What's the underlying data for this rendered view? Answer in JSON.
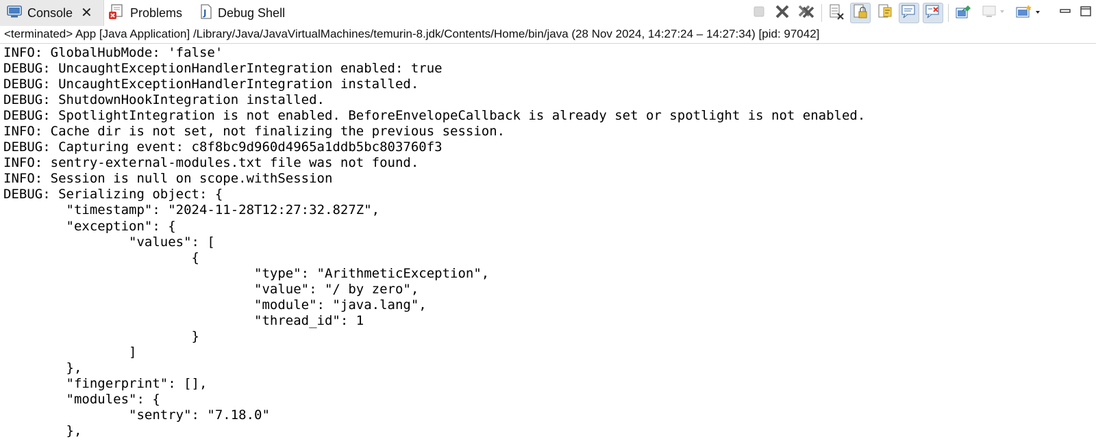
{
  "tabs": [
    {
      "label": "Console",
      "icon": "console-icon",
      "active": true
    },
    {
      "label": "Problems",
      "icon": "problems-icon",
      "active": false
    },
    {
      "label": "Debug Shell",
      "icon": "debug-shell-icon",
      "active": false
    }
  ],
  "toolbar": {
    "icons": [
      "terminate-icon",
      "remove-launch-icon",
      "remove-all-terminated-icon",
      "clear-console-icon",
      "scroll-lock-icon",
      "word-wrap-icon",
      "show-on-stdout-icon",
      "show-on-stderr-icon",
      "pin-console-icon",
      "display-selected-console-icon",
      "open-console-icon",
      "minimize-icon",
      "maximize-icon"
    ]
  },
  "status": {
    "text": "<terminated> App [Java Application] /Library/Java/JavaVirtualMachines/temurin-8.jdk/Contents/Home/bin/java  (28 Nov 2024, 14:27:24 – 14:27:34) [pid: 97042]"
  },
  "console": {
    "lines": [
      "INFO: GlobalHubMode: 'false'",
      "DEBUG: UncaughtExceptionHandlerIntegration enabled: true",
      "DEBUG: UncaughtExceptionHandlerIntegration installed.",
      "DEBUG: ShutdownHookIntegration installed.",
      "DEBUG: SpotlightIntegration is not enabled. BeforeEnvelopeCallback is already set or spotlight is not enabled.",
      "INFO: Cache dir is not set, not finalizing the previous session.",
      "DEBUG: Capturing event: c8f8bc9d960d4965a1ddb5bc803760f3",
      "INFO: sentry-external-modules.txt file was not found.",
      "INFO: Session is null on scope.withSession",
      "DEBUG: Serializing object: {",
      "\t\"timestamp\": \"2024-11-28T12:27:32.827Z\",",
      "\t\"exception\": {",
      "\t\t\"values\": [",
      "\t\t\t{",
      "\t\t\t\t\"type\": \"ArithmeticException\",",
      "\t\t\t\t\"value\": \"/ by zero\",",
      "\t\t\t\t\"module\": \"java.lang\",",
      "\t\t\t\t\"thread_id\": 1",
      "\t\t\t}",
      "\t\t]",
      "\t},",
      "\t\"fingerprint\": [],",
      "\t\"modules\": {",
      "\t\t\"sentry\": \"7.18.0\"",
      "\t},"
    ]
  }
}
